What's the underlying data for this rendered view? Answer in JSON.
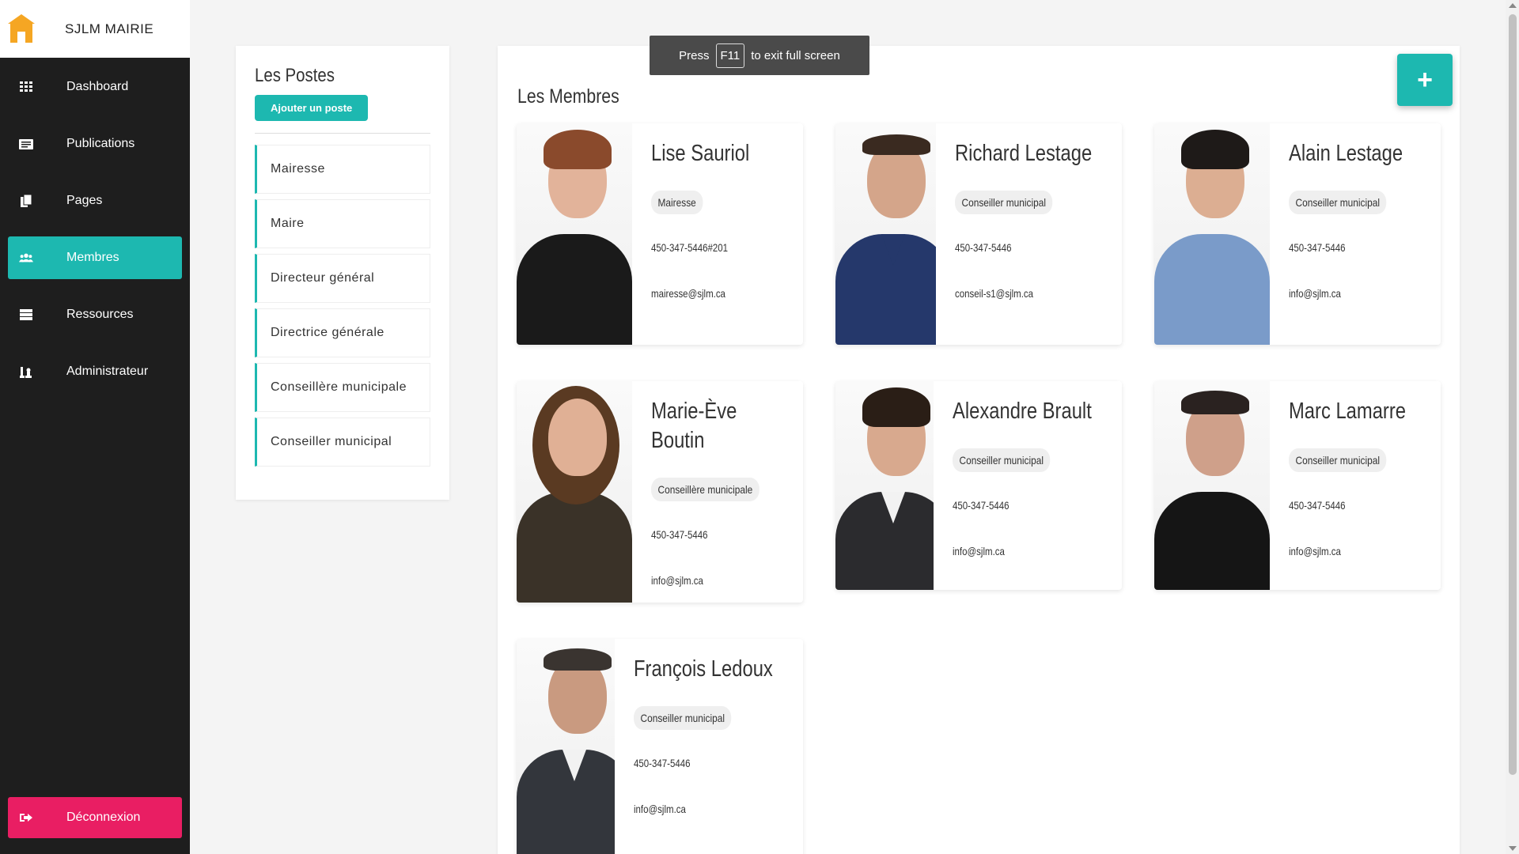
{
  "brand": {
    "title": "SJLM MAIRIE",
    "logo_icon": "house-logo-icon"
  },
  "sidebar": {
    "items": [
      {
        "label": "Dashboard",
        "icon": "grid-icon"
      },
      {
        "label": "Publications",
        "icon": "newspaper-icon"
      },
      {
        "label": "Pages",
        "icon": "copy-icon"
      },
      {
        "label": "Membres",
        "icon": "users-icon",
        "active": true
      },
      {
        "label": "Ressources",
        "icon": "server-icon"
      },
      {
        "label": "Administrateur",
        "icon": "chess-icon"
      }
    ],
    "logout_label": "Déconnexion",
    "logout_icon": "sign-out-icon"
  },
  "toast": {
    "press": "Press",
    "key": "F11",
    "rest": "to exit full screen"
  },
  "postes": {
    "title": "Les Postes",
    "add_label": "Ajouter un poste",
    "items": [
      "Mairesse",
      "Maire",
      "Directeur général",
      "Directrice générale",
      "Conseillère municipale",
      "Conseiller municipal"
    ]
  },
  "membres": {
    "title": "Les Membres",
    "add_button": "+",
    "cards": [
      {
        "name": "Lise Sauriol",
        "role": "Mairesse",
        "phone": "450-347-5446#201",
        "email": "mairesse@sjlm.ca"
      },
      {
        "name": "Richard Lestage",
        "role": "Conseiller municipal",
        "phone": "450-347-5446",
        "email": "conseil-s1@sjlm.ca"
      },
      {
        "name": "Alain Lestage",
        "role": "Conseiller municipal",
        "phone": "450-347-5446",
        "email": "info@sjlm.ca"
      },
      {
        "name": "Marie-Ève Boutin",
        "role": "Conseillère municipale",
        "phone": "450-347-5446",
        "email": "info@sjlm.ca"
      },
      {
        "name": "Alexandre Brault",
        "role": "Conseiller municipal",
        "phone": "450-347-5446",
        "email": "info@sjlm.ca"
      },
      {
        "name": "Marc Lamarre",
        "role": "Conseiller municipal",
        "phone": "450-347-5446",
        "email": "info@sjlm.ca"
      },
      {
        "name": "François Ledoux",
        "role": "Conseiller municipal",
        "phone": "450-347-5446",
        "email": "info@sjlm.ca"
      }
    ]
  },
  "colors": {
    "accent": "#1db8b0",
    "logout": "#e91e63",
    "sidebar": "#1e1e1e"
  }
}
